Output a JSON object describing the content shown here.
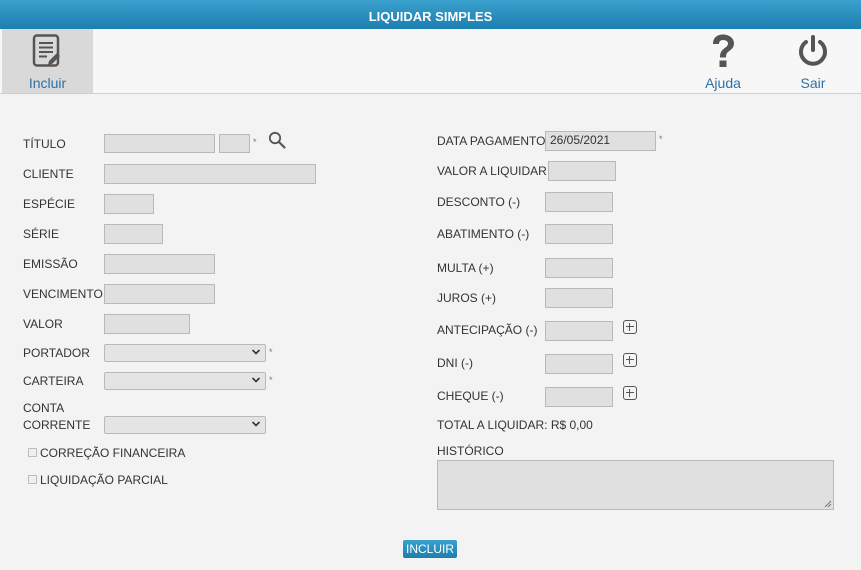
{
  "window": {
    "title": "LIQUIDAR SIMPLES"
  },
  "toolbar": {
    "incluir_label": "Incluir",
    "ajuda_label": "Ajuda",
    "sair_label": "Sair"
  },
  "left": {
    "titulo_label": "TÍTULO",
    "cliente_label": "CLIENTE",
    "especie_label": "ESPÉCIE",
    "serie_label": "SÉRIE",
    "emissao_label": "EMISSÃO",
    "vencimento_label": "VENCIMENTO",
    "valor_label": "VALOR",
    "portador_label": "PORTADOR",
    "carteira_label": "CARTEIRA",
    "conta_label_1": "CONTA",
    "conta_label_2": "CORRENTE",
    "correcao_label": "CORREÇÃO FINANCEIRA",
    "liquidacao_label": "LIQUIDAÇÃO PARCIAL",
    "required_mark": "*"
  },
  "right": {
    "data_pagamento_label": "DATA PAGAMENTO",
    "data_pagamento_value": "26/05/2021",
    "valor_liquidar_label": "VALOR A LIQUIDAR",
    "desconto_label": "DESCONTO (-)",
    "abatimento_label": "ABATIMENTO (-)",
    "multa_label": "MULTA (+)",
    "juros_label": "JUROS (+)",
    "antecipacao_label": "ANTECIPAÇÃO (-)",
    "dni_label": "DNI (-)",
    "cheque_label": "CHEQUE (-)",
    "total_label": "TOTAL A LIQUIDAR: R$ 0,00",
    "historico_label": "HISTÓRICO"
  },
  "footer": {
    "incluir_button": "INCLUIR"
  },
  "colors": {
    "accent": "#1c7fb0",
    "toolbar_link": "#2f6fa8"
  },
  "icons": {
    "incluir": "document-edit-icon",
    "ajuda": "question-mark-icon",
    "sair": "power-icon",
    "search": "search-icon",
    "plus": "plus-square-icon"
  }
}
